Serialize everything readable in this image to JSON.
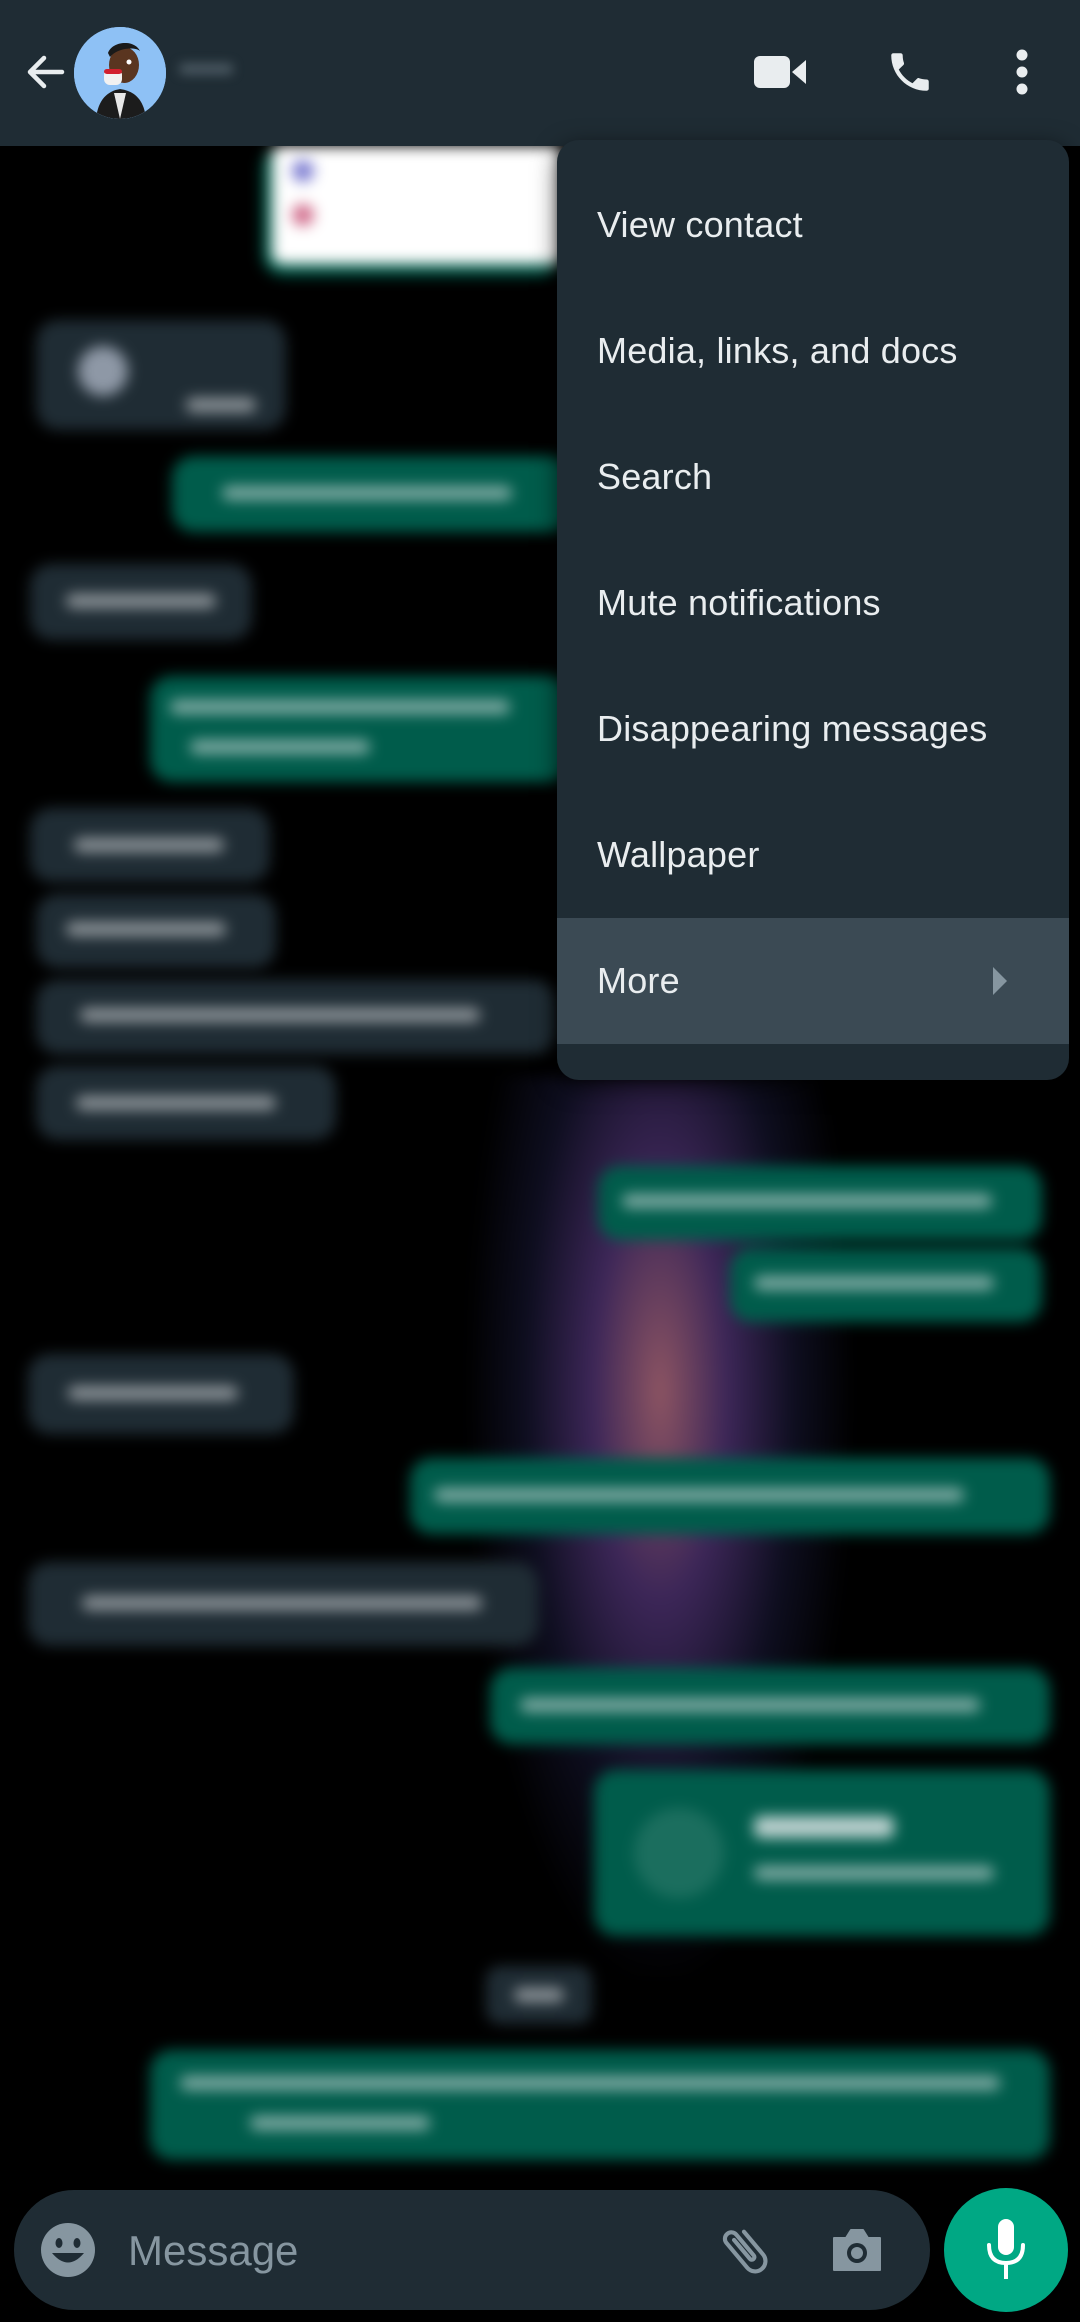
{
  "header": {
    "back_label": "Back",
    "contact_name": "•••••",
    "icons": [
      "back-arrow-icon",
      "video-call-icon",
      "voice-call-icon",
      "more-options-icon"
    ]
  },
  "menu": {
    "items": [
      {
        "label": "View contact",
        "has_submenu": false
      },
      {
        "label": "Media, links, and docs",
        "has_submenu": false
      },
      {
        "label": "Search",
        "has_submenu": false
      },
      {
        "label": "Mute notifications",
        "has_submenu": false
      },
      {
        "label": "Disappearing messages",
        "has_submenu": false
      },
      {
        "label": "Wallpaper",
        "has_submenu": false
      },
      {
        "label": "More",
        "has_submenu": true,
        "highlighted": true
      }
    ]
  },
  "chat": {
    "content_blurred": true,
    "message_directions": [
      "out-image",
      "in",
      "out",
      "in",
      "out",
      "in",
      "in",
      "in",
      "in",
      "out",
      "out",
      "in",
      "out",
      "in",
      "out",
      "out-doc",
      "date-chip",
      "out"
    ]
  },
  "composer": {
    "placeholder": "Message",
    "value": "",
    "icons": [
      "emoji-icon",
      "attach-icon",
      "camera-icon",
      "microphone-icon"
    ]
  },
  "colors": {
    "header_bg": "#1f2c34",
    "menu_bg": "#1f2c34",
    "menu_highlight": "#3b4a54",
    "incoming_bubble": "#1f2c34",
    "outgoing_bubble": "#005c4b",
    "accent": "#00a884",
    "icon_muted": "#8696a0"
  }
}
